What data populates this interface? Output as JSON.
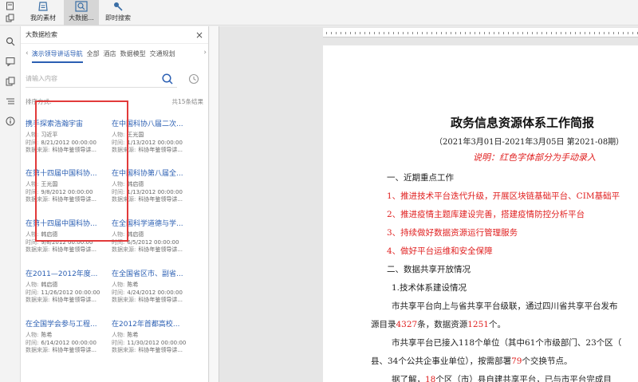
{
  "toolbar": {
    "items": [
      {
        "label": "我的素材",
        "icon": "folder-icon"
      },
      {
        "label": "大数据...",
        "icon": "search-data-icon"
      },
      {
        "label": "即时搜索",
        "icon": "pin-search-icon"
      }
    ]
  },
  "panel": {
    "title": "大数据检索",
    "close": "×",
    "tabs": [
      "演示领导讲话导航",
      "全部",
      "酒店",
      "数据模型",
      "交通规划"
    ],
    "search_placeholder": "请输入内容",
    "sort_label": "排序方式:",
    "total": "共15条结果"
  },
  "results": [
    {
      "title": "携手探索浩瀚宇宙",
      "person": "习近平",
      "time": "8/21/2012 00:00:00",
      "source": "科协年鉴领导讲..."
    },
    {
      "title": "在中国科协八届二次...",
      "person": "王光国",
      "time": "1/13/2012 00:00:00",
      "source": "科协年鉴领导讲..."
    },
    {
      "title": "在第十四届中国科协...",
      "person": "王光国",
      "time": "9/8/2012 00:00:00",
      "source": "科协年鉴领导讲..."
    },
    {
      "title": "在中国科协第八届全...",
      "person": "韩启德",
      "time": "1/13/2012 00:00:00",
      "source": "科协年鉴领导讲..."
    },
    {
      "title": "在第十四届中国科协...",
      "person": "韩启德",
      "time": "9/8/2012 00:00:00",
      "source": "科协年鉴领导讲..."
    },
    {
      "title": "在全国科学道德与学...",
      "person": "韩启德",
      "time": "6/5/2012 00:00:00",
      "source": "科协年鉴领导讲..."
    },
    {
      "title": "在2011—2012年度...",
      "person": "韩启德",
      "time": "11/26/2012 00:00:00",
      "source": "科协年鉴领导讲..."
    },
    {
      "title": "在全国省区市、副省...",
      "person": "陈希",
      "time": "4/24/2012 00:00:00",
      "source": "科协年鉴领导讲..."
    },
    {
      "title": "在全国学会参与工程...",
      "person": "陈希",
      "time": "6/14/2012 00:00:00",
      "source": "科协年鉴领导讲..."
    },
    {
      "title": "在2012年首都高校...",
      "person": "陈希",
      "time": "11/30/2012 00:00:00",
      "source": "科协年鉴领导讲..."
    }
  ],
  "result_labels": {
    "person": "人物:",
    "time": "时间:",
    "source": "数据来源:"
  },
  "document": {
    "title": "政务信息资源体系工作简报",
    "subtitle": "（2021年3月01日-2021年3月05日 第2021-08期）",
    "note": "说明：红色字体部分为手动录入",
    "section1": "一、近期重点工作",
    "items": [
      "1、推进技术平台迭代升级，开展区块链基础平台、CIM基础平",
      "2、推进疫情主题库建设完善，搭建疫情防控分析平台",
      "3、持续做好数据资源运行管理服务",
      "4、做好平台运维和安全保障"
    ],
    "section2": "二、数据共享开放情况",
    "sub1": "1.技术体系建设情况",
    "p1a": "市共享平台向上与省共享平台级联，通过四川省共享平台发布",
    "p1b_pre": "源目录",
    "p1b_n1": "4327",
    "p1b_mid": "条，数据资源",
    "p1b_n2": "1251",
    "p1b_post": "个。",
    "p2a": "市共享平台已接入118个单位（其中61个市级部门、23个区（",
    "p2b_pre": "县、34个公共企事业单位），按需部署",
    "p2b_n": "79",
    "p2b_post": "个交换节点。",
    "p3_pre": "据了解，",
    "p3_n": "18",
    "p3_post": "个区（市）县自建共享平台，已与市平台完成目"
  }
}
